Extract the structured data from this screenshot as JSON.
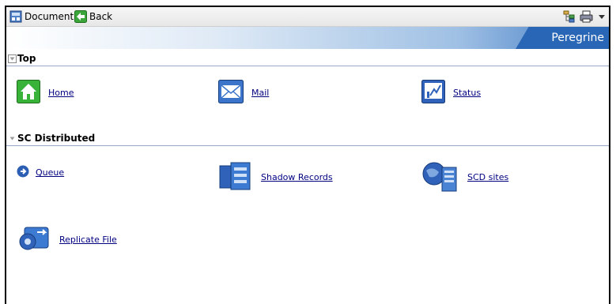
{
  "toolbar": {
    "document_label": "Document",
    "back_label": "Back"
  },
  "brand": {
    "name": "Peregrine"
  },
  "sections": [
    {
      "title": "Top",
      "items": [
        {
          "label": "Home",
          "icon": "home-icon"
        },
        {
          "label": "Mail",
          "icon": "mail-icon"
        },
        {
          "label": "Status",
          "icon": "status-chart-icon"
        }
      ]
    },
    {
      "title": "SC Distributed",
      "items": [
        {
          "label": "Queue",
          "icon": "queue-arrow-icon"
        },
        {
          "label": "Shadow Records",
          "icon": "shadow-records-icon"
        },
        {
          "label": "SCD sites",
          "icon": "scd-sites-icon"
        },
        {
          "label": "Replicate File",
          "icon": "replicate-file-icon"
        }
      ]
    }
  ]
}
